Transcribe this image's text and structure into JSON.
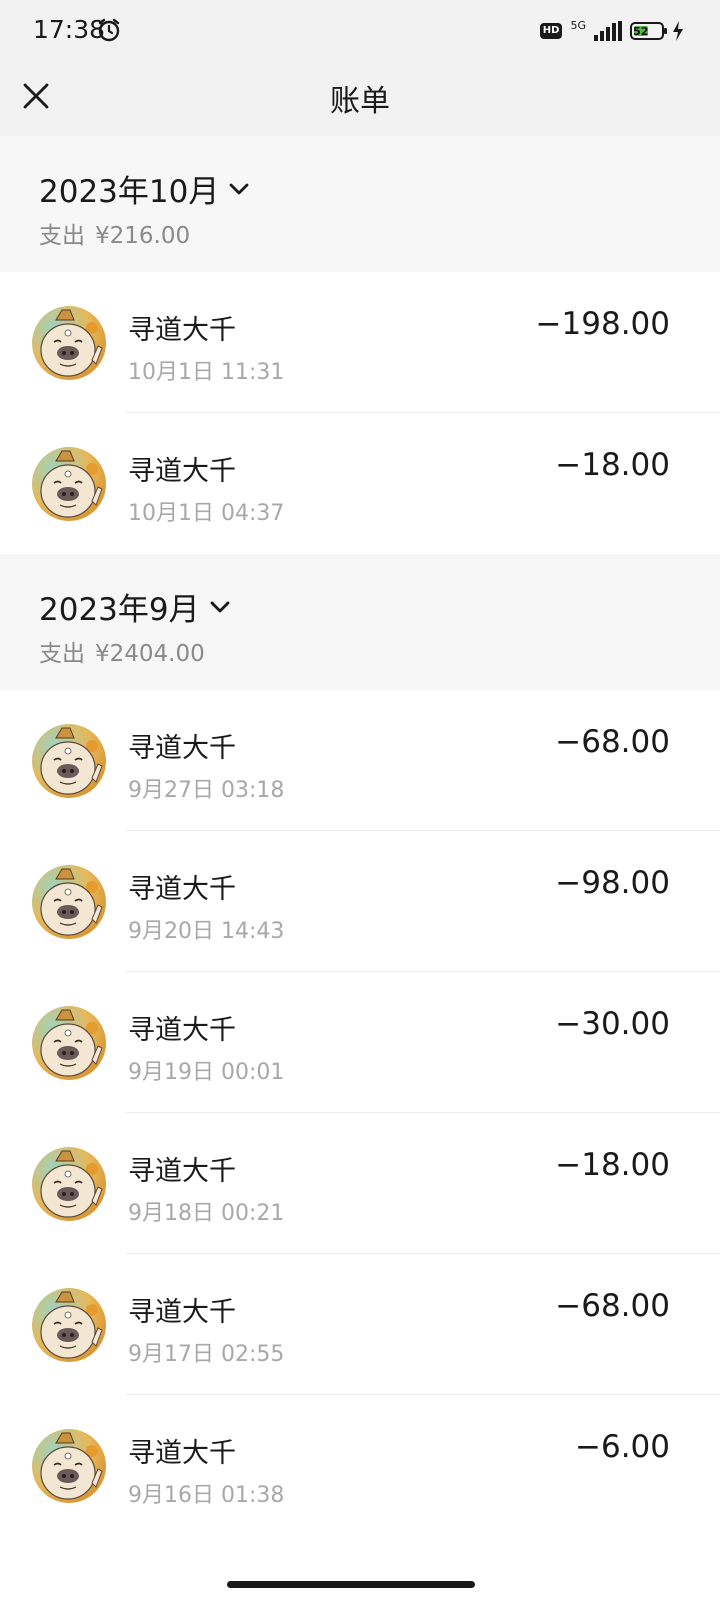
{
  "status_bar": {
    "time": "17:38",
    "hd": "HD",
    "network": "5G",
    "battery": "52"
  },
  "header": {
    "title": "账单"
  },
  "months": [
    {
      "title": "2023年10月",
      "expense_label": "支出",
      "expense_amount": "¥216.00",
      "transactions": [
        {
          "name": "寻道大千",
          "time": "10月1日 11:31",
          "amount": "−198.00"
        },
        {
          "name": "寻道大千",
          "time": "10月1日 04:37",
          "amount": "−18.00"
        }
      ]
    },
    {
      "title": "2023年9月",
      "expense_label": "支出",
      "expense_amount": "¥2404.00",
      "transactions": [
        {
          "name": "寻道大千",
          "time": "9月27日 03:18",
          "amount": "−68.00"
        },
        {
          "name": "寻道大千",
          "time": "9月20日 14:43",
          "amount": "−98.00"
        },
        {
          "name": "寻道大千",
          "time": "9月19日 00:01",
          "amount": "−30.00"
        },
        {
          "name": "寻道大千",
          "time": "9月18日 00:21",
          "amount": "−18.00"
        },
        {
          "name": "寻道大千",
          "time": "9月17日 02:55",
          "amount": "−68.00"
        },
        {
          "name": "寻道大千",
          "time": "9月16日 01:38",
          "amount": "−6.00"
        }
      ]
    }
  ],
  "colors": {
    "accent": "#1a1a1a",
    "muted": "#8a8a8a",
    "battery": "#57b947"
  },
  "icons": {
    "close": "close-icon",
    "chevron": "chevron-down-icon",
    "alarm": "alarm-icon",
    "avatar": "pig-avatar-icon"
  }
}
